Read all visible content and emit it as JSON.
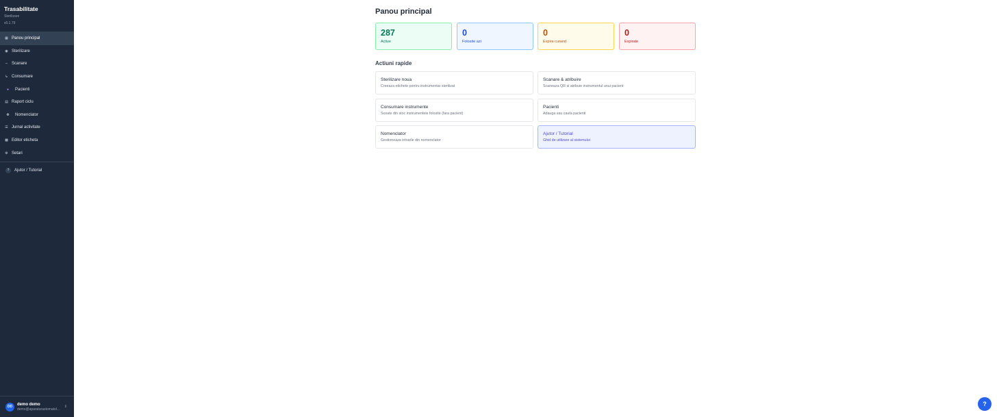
{
  "app": {
    "title": "Trasabilitate",
    "subtitle": "Sterilizare",
    "version": "v0.1.79"
  },
  "sidebar": {
    "items": [
      {
        "label": "Panou principal",
        "icon": "grid-icon"
      },
      {
        "label": "Sterilizare",
        "icon": "radiation-icon"
      },
      {
        "label": "Scanare",
        "icon": "scan-icon"
      },
      {
        "label": "Consumare",
        "icon": "consume-icon"
      },
      {
        "label": "Pacienti",
        "icon": "person-icon"
      },
      {
        "label": "Raport ciclu",
        "icon": "report-icon"
      },
      {
        "label": "Nomenclator",
        "icon": "gear-icon"
      },
      {
        "label": "Jurnal activitate",
        "icon": "list-icon"
      },
      {
        "label": "Editor eticheta",
        "icon": "label-icon"
      },
      {
        "label": "Setari",
        "icon": "settings-icon"
      }
    ],
    "help": {
      "label": "Ajutor / Tutorial",
      "icon_text": "?"
    }
  },
  "user": {
    "initials": "DD",
    "name": "demo demo",
    "email": "demo@aparaturastomatol..."
  },
  "main": {
    "title": "Panou principal",
    "stats": [
      {
        "value": "287",
        "label": "Active"
      },
      {
        "value": "0",
        "label": "Folosite azi"
      },
      {
        "value": "0",
        "label": "Expira curand"
      },
      {
        "value": "0",
        "label": "Expirate"
      }
    ],
    "quick_title": "Actiuni rapide",
    "actions": [
      {
        "title": "Sterilizare noua",
        "desc": "Creeaza etichete pentru instrumentar sterilizat"
      },
      {
        "title": "Scanare & atribuire",
        "desc": "Scaneaza QR si atribuie instrumentul unui pacient"
      },
      {
        "title": "Consumare instrumente",
        "desc": "Scoate din stoc instrumentele folosite (fara pacient)"
      },
      {
        "title": "Pacienti",
        "desc": "Adauga sau cauta pacienti"
      },
      {
        "title": "Nomenclator",
        "desc": "Gestioneaza intrarile din nomenclator"
      },
      {
        "title": "Ajutor / Tutorial",
        "desc": "Ghid de utilizare al sistemului"
      }
    ]
  },
  "fab": {
    "label": "?"
  },
  "colors": {
    "sidebar_bg": "#1e293b",
    "accent": "#2563eb"
  }
}
